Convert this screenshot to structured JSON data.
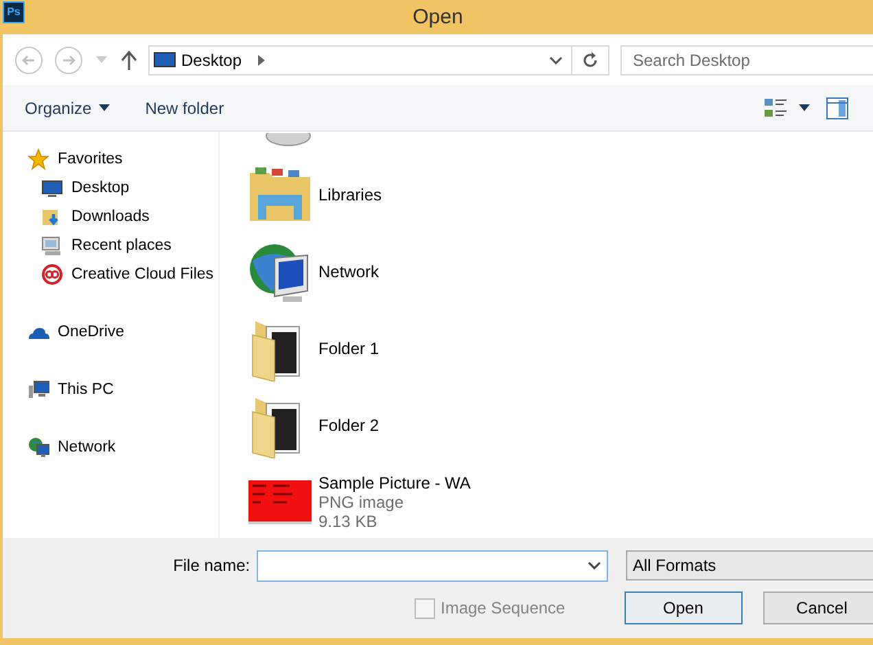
{
  "window": {
    "title": "Open",
    "app_badge": "Ps"
  },
  "address_bar": {
    "location": "Desktop"
  },
  "search": {
    "placeholder": "Search Desktop"
  },
  "toolbar": {
    "organize": "Organize",
    "new_folder": "New folder"
  },
  "sidebar": {
    "groups": [
      {
        "label": "Favorites",
        "kind": "star",
        "children": [
          {
            "label": "Desktop",
            "kind": "desktop"
          },
          {
            "label": "Downloads",
            "kind": "downloads"
          },
          {
            "label": "Recent places",
            "kind": "recent"
          },
          {
            "label": "Creative Cloud Files",
            "kind": "cloudfiles"
          }
        ]
      },
      {
        "label": "OneDrive",
        "kind": "cloud"
      },
      {
        "label": "This PC",
        "kind": "pc"
      },
      {
        "label": "Network",
        "kind": "network"
      }
    ]
  },
  "files": [
    {
      "name": "Libraries",
      "kind": "libraries"
    },
    {
      "name": "Network",
      "kind": "network"
    },
    {
      "name": "Folder 1",
      "kind": "folder"
    },
    {
      "name": "Folder 2",
      "kind": "folder"
    },
    {
      "name": "Sample Picture - WA",
      "type": "PNG image",
      "size": "9.13 KB"
    }
  ],
  "footer": {
    "file_name_label": "File name:",
    "filter": "All Formats",
    "checkbox": {
      "label": "Image Sequence",
      "checked": false,
      "disabled": true
    },
    "buttons": [
      {
        "label": "Open",
        "default": true
      },
      {
        "label": "Cancel",
        "default": false
      }
    ]
  }
}
